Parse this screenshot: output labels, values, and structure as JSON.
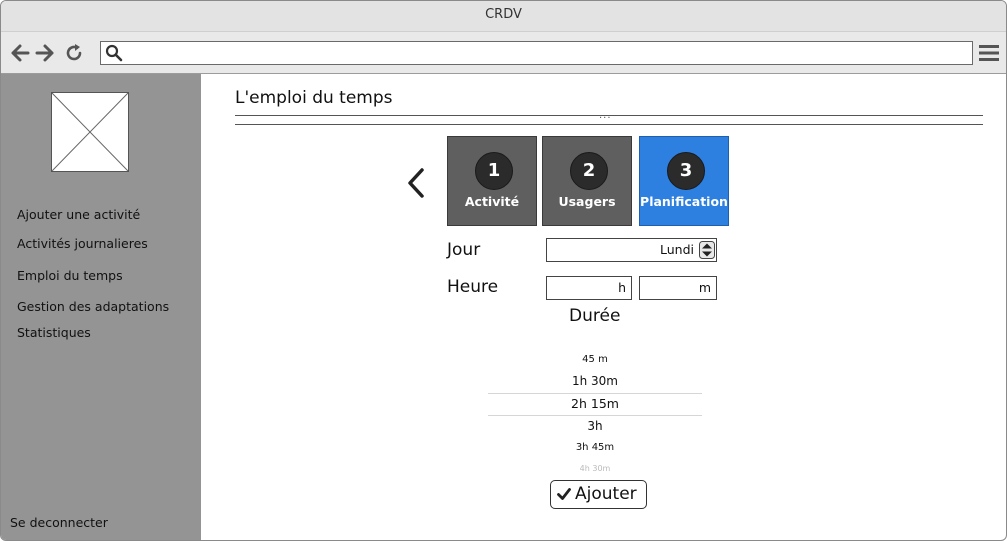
{
  "window": {
    "title": "CRDV"
  },
  "toolbar": {
    "address_value": ""
  },
  "sidebar": {
    "items": [
      {
        "label": "Ajouter une activité"
      },
      {
        "label": "Activités journalieres"
      },
      {
        "label": "Emploi du temps"
      },
      {
        "label": "Gestion des adaptations"
      },
      {
        "label": "Statistiques"
      }
    ],
    "logout_label": "Se deconnecter"
  },
  "main": {
    "title": "L'emploi du temps",
    "divider_dots": "...",
    "steps": [
      {
        "number": "1",
        "label": "Activité",
        "active": false
      },
      {
        "number": "2",
        "label": "Usagers",
        "active": false
      },
      {
        "number": "3",
        "label": "Planification",
        "active": true
      }
    ],
    "form": {
      "day_label": "Jour",
      "day_value": "Lundi",
      "hour_label": "Heure",
      "hour_unit": "h",
      "minute_unit": "m",
      "duration_label": "Durée",
      "duration_options": [
        "45 m",
        "1h 30m",
        "2h 15m",
        "3h",
        "3h 45m",
        "4h 30m"
      ],
      "duration_selected": "2h 15m",
      "add_label": "Ajouter"
    }
  },
  "colors": {
    "sidebar_bg": "#949494",
    "step_bg": "#5f5f5f",
    "step_active_bg": "#2d7fe0"
  }
}
